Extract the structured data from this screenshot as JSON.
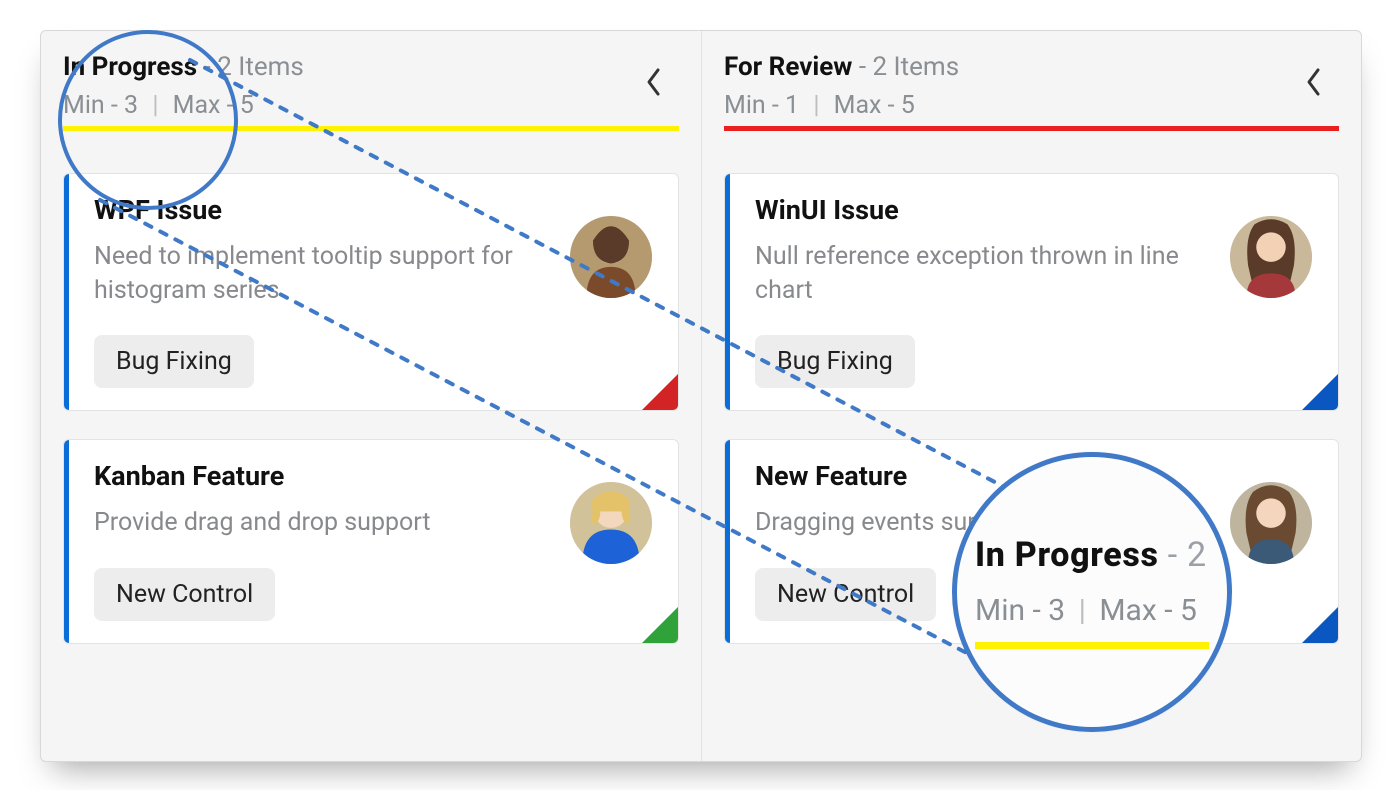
{
  "columns": [
    {
      "title": "In Progress",
      "count": 2,
      "count_suffix": "Items",
      "min_label": "Min",
      "min": 3,
      "max_label": "Max",
      "max": 5,
      "bar_color": "yellow",
      "cards": [
        {
          "title": "WPF Issue",
          "description": "Need to implement tooltip support for histogram series",
          "chip": "Bug Fixing",
          "accent": "blue",
          "corner": "red"
        },
        {
          "title": "Kanban Feature",
          "description": "Provide drag and drop support",
          "chip": "New Control",
          "accent": "blue",
          "corner": "green"
        }
      ]
    },
    {
      "title": "For Review",
      "count": 2,
      "count_suffix": "Items",
      "min_label": "Min",
      "min": 1,
      "max_label": "Max",
      "max": 5,
      "bar_color": "red",
      "cards": [
        {
          "title": "WinUI Issue",
          "description": "Null reference exception thrown in line chart",
          "chip": "Bug Fixing",
          "accent": "blue",
          "corner": "blue"
        },
        {
          "title": "New Feature",
          "description": "Dragging events support for kanban",
          "chip": "New Control",
          "accent": "blue",
          "corner": "blue"
        }
      ]
    }
  ],
  "callout": {
    "title": "In Progress",
    "count": 2,
    "min_label": "Min",
    "min": 3,
    "max_label": "Max",
    "max": 5
  }
}
